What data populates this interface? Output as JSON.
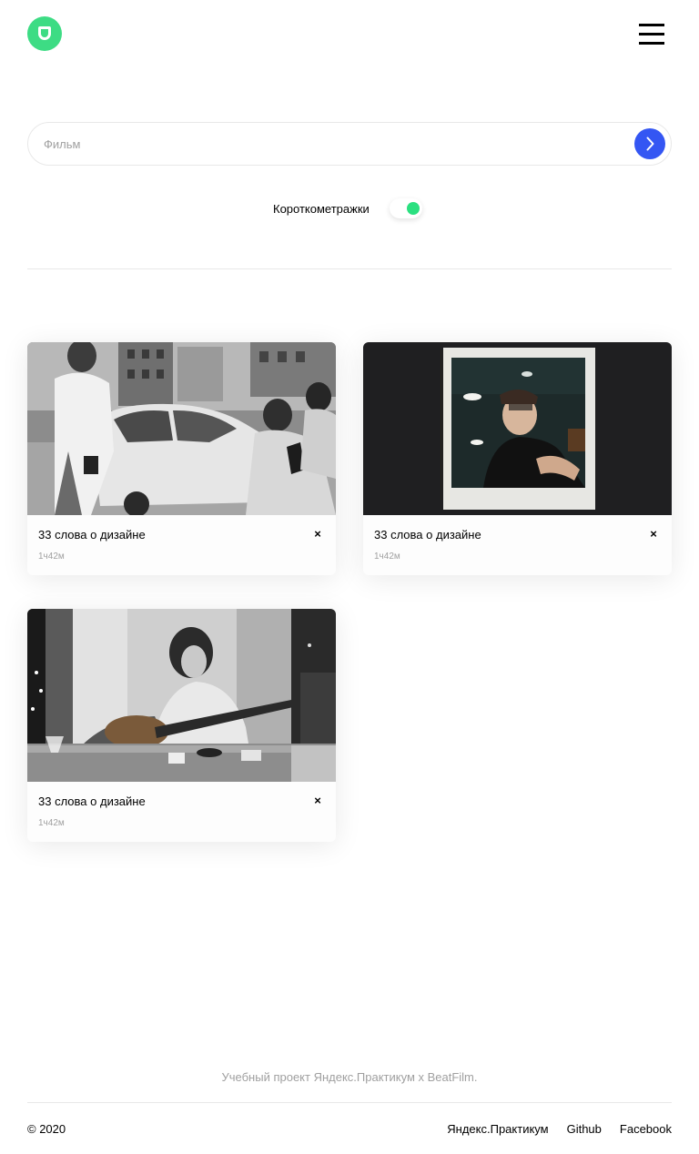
{
  "header": {
    "logo_icon": "logo-icon",
    "menu_icon": "burger-menu-icon"
  },
  "search": {
    "placeholder": "Фильм",
    "value": "",
    "submit_icon": "chevron-right-icon",
    "accent": "#3456f3"
  },
  "filter": {
    "label": "Короткометражки",
    "enabled": true,
    "accent": "#2be080"
  },
  "movies": [
    {
      "title": "33 слова о дизайне",
      "duration": "1ч42м",
      "delete_label": "×",
      "thumb": "street-photographer-photo"
    },
    {
      "title": "33 слова о дизайне",
      "duration": "1ч42м",
      "delete_label": "×",
      "thumb": "polaroid-portrait-photo"
    },
    {
      "title": "33 слова о дизайне",
      "duration": "1ч42м",
      "delete_label": "×",
      "thumb": "guitarist-photo"
    }
  ],
  "footer": {
    "note": "Учебный проект Яндекс.Практикум х BeatFilm.",
    "copyright": "© 2020",
    "links": [
      "Яндекс.Практикум",
      "Github",
      "Facebook"
    ]
  }
}
